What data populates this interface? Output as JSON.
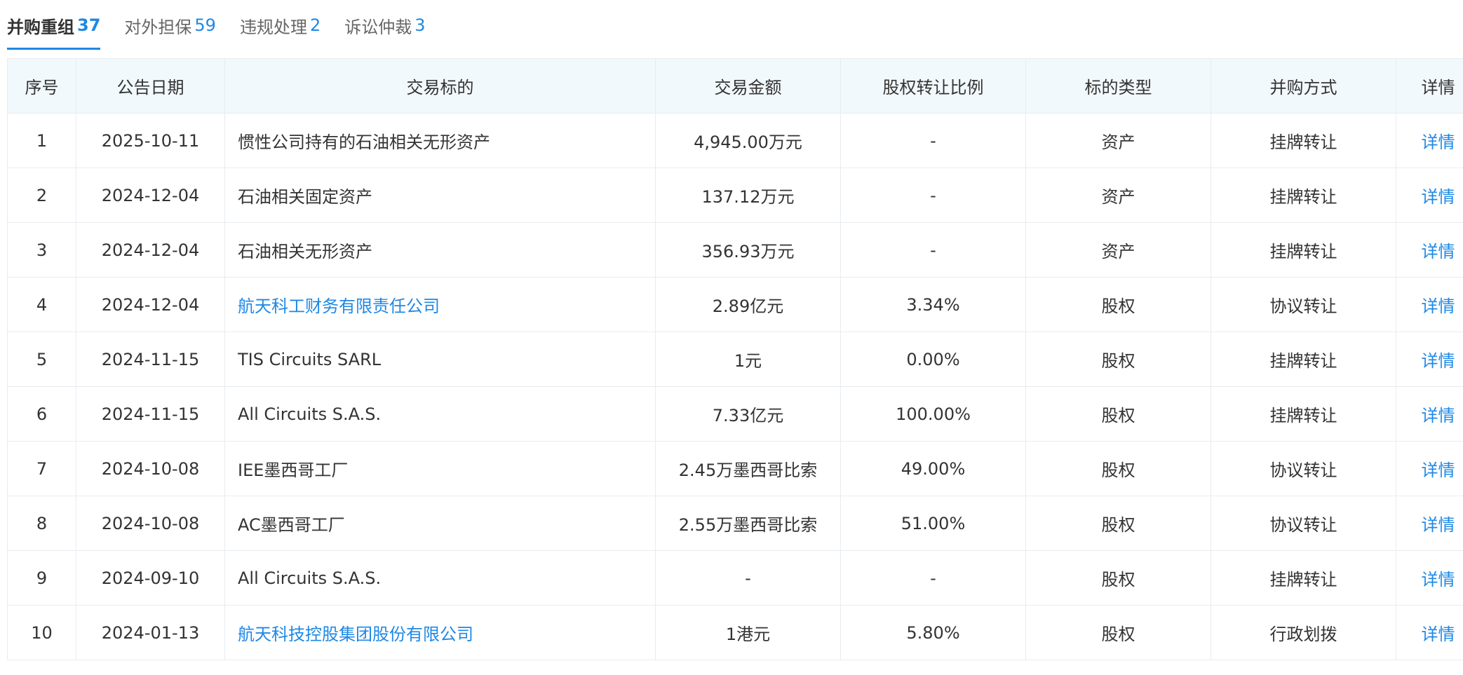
{
  "tabs": [
    {
      "label": "并购重组",
      "count": "37",
      "active": true
    },
    {
      "label": "对外担保",
      "count": "59",
      "active": false
    },
    {
      "label": "违规处理",
      "count": "2",
      "active": false
    },
    {
      "label": "诉讼仲裁",
      "count": "3",
      "active": false
    }
  ],
  "table": {
    "headers": {
      "index": "序号",
      "date": "公告日期",
      "target": "交易标的",
      "amount": "交易金额",
      "ratio": "股权转让比例",
      "type": "标的类型",
      "method": "并购方式",
      "detail": "详情"
    },
    "rows": [
      {
        "index": "1",
        "date": "2025-10-11",
        "target": "惯性公司持有的石油相关无形资产",
        "target_link": false,
        "amount": "4,945.00万元",
        "ratio": "-",
        "type": "资产",
        "method": "挂牌转让",
        "detail": "详情"
      },
      {
        "index": "2",
        "date": "2024-12-04",
        "target": "石油相关固定资产",
        "target_link": false,
        "amount": "137.12万元",
        "ratio": "-",
        "type": "资产",
        "method": "挂牌转让",
        "detail": "详情"
      },
      {
        "index": "3",
        "date": "2024-12-04",
        "target": "石油相关无形资产",
        "target_link": false,
        "amount": "356.93万元",
        "ratio": "-",
        "type": "资产",
        "method": "挂牌转让",
        "detail": "详情"
      },
      {
        "index": "4",
        "date": "2024-12-04",
        "target": "航天科工财务有限责任公司",
        "target_link": true,
        "amount": "2.89亿元",
        "ratio": "3.34%",
        "type": "股权",
        "method": "协议转让",
        "detail": "详情"
      },
      {
        "index": "5",
        "date": "2024-11-15",
        "target": "TIS Circuits SARL",
        "target_link": false,
        "amount": "1元",
        "ratio": "0.00%",
        "type": "股权",
        "method": "挂牌转让",
        "detail": "详情"
      },
      {
        "index": "6",
        "date": "2024-11-15",
        "target": "All Circuits S.A.S.",
        "target_link": false,
        "amount": "7.33亿元",
        "ratio": "100.00%",
        "type": "股权",
        "method": "挂牌转让",
        "detail": "详情"
      },
      {
        "index": "7",
        "date": "2024-10-08",
        "target": "IEE墨西哥工厂",
        "target_link": false,
        "amount": "2.45万墨西哥比索",
        "ratio": "49.00%",
        "type": "股权",
        "method": "协议转让",
        "detail": "详情"
      },
      {
        "index": "8",
        "date": "2024-10-08",
        "target": "AC墨西哥工厂",
        "target_link": false,
        "amount": "2.55万墨西哥比索",
        "ratio": "51.00%",
        "type": "股权",
        "method": "协议转让",
        "detail": "详情"
      },
      {
        "index": "9",
        "date": "2024-09-10",
        "target": "All Circuits S.A.S.",
        "target_link": false,
        "amount": "-",
        "ratio": "-",
        "type": "股权",
        "method": "挂牌转让",
        "detail": "详情"
      },
      {
        "index": "10",
        "date": "2024-01-13",
        "target": "航天科技控股集团股份有限公司",
        "target_link": true,
        "amount": "1港元",
        "ratio": "5.80%",
        "type": "股权",
        "method": "行政划拨",
        "detail": "详情"
      }
    ]
  },
  "colors": {
    "accent": "#1e88e5",
    "header_bg": "#f2f9fc",
    "border": "#e8ecf0",
    "text": "#333333"
  }
}
